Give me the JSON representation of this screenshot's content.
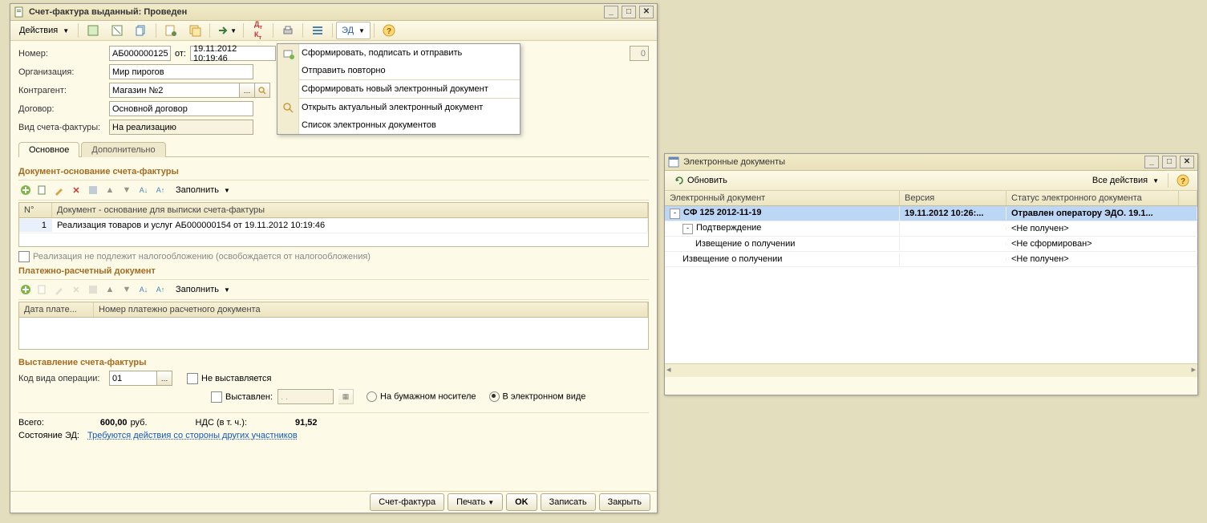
{
  "win1": {
    "title": "Счет-фактура выданный: Проведен",
    "toolbar": {
      "actions": "Действия",
      "ed_label": "ЭД"
    },
    "fields": {
      "number_label": "Номер:",
      "number_value": "АБ000000125",
      "from_label": "от:",
      "date_value": "19.11.2012 10:19:46",
      "right_zero": "0",
      "org_label": "Организация:",
      "org_value": "Мир пирогов",
      "counter_label": "Контрагент:",
      "counter_value": "Магазин №2",
      "contract_label": "Договор:",
      "contract_value": "Основной договор",
      "type_label": "Вид счета-фактуры:",
      "type_value": "На реализацию"
    },
    "tabs": {
      "main": "Основное",
      "extra": "Дополнительно"
    },
    "section1": {
      "title": "Документ-основание счета-фактуры",
      "fill": "Заполнить",
      "col_n": "N°",
      "col_doc": "Документ - основание для выписки счета-фактуры",
      "row_n": "1",
      "row_doc": "Реализация товаров и услуг АБ000000154 от 19.11.2012 10:19:46",
      "taxfree": "Реализация не подлежит налогообложению (освобождается от налогообложения)"
    },
    "section2": {
      "title": "Платежно-расчетный документ",
      "fill": "Заполнить",
      "col_date": "Дата плате...",
      "col_num": "Номер платежно расчетного документа"
    },
    "section3": {
      "title": "Выставление счета-фактуры",
      "opcode_label": "Код вида операции:",
      "opcode_value": "01",
      "not_issued": "Не выставляется",
      "issued": "Выставлен:",
      "issued_date": ". .",
      "paper": "На бумажном носителе",
      "electronic": "В электронном виде"
    },
    "totals": {
      "total_label": "Всего:",
      "total_value": "600,00",
      "currency": "руб.",
      "nds_label": "НДС (в т. ч.):",
      "nds_value": "91,52",
      "state_label": "Состояние ЭД:",
      "state_link": "Требуются действия со стороны других участников"
    },
    "footer": {
      "invoice": "Счет-фактура",
      "print": "Печать",
      "ok": "OK",
      "save": "Записать",
      "close": "Закрыть"
    },
    "dropdown": {
      "i1": "Сформировать, подписать и отправить",
      "i2": "Отправить повторно",
      "i3": "Сформировать новый электронный документ",
      "i4": "Открыть актуальный электронный документ",
      "i5": "Список электронных документов"
    }
  },
  "win2": {
    "title": "Электронные документы",
    "toolbar": {
      "refresh": "Обновить",
      "all_actions": "Все действия"
    },
    "cols": {
      "doc": "Электронный документ",
      "ver": "Версия",
      "status": "Статус электронного документа"
    },
    "rows": [
      {
        "name": "СФ 125 2012-11-19",
        "ver": "19.11.2012 10:26:...",
        "status": "Отравлен оператору ЭДО. 19.1...",
        "indent": 0,
        "expander": "-",
        "sel": true,
        "bold": true
      },
      {
        "name": "Подтверждение",
        "ver": "",
        "status": "<Не получен>",
        "indent": 1,
        "expander": "-",
        "sel": false,
        "bold": false
      },
      {
        "name": "Извещение о получении",
        "ver": "",
        "status": "<Не сформирован>",
        "indent": 2,
        "expander": "",
        "sel": false,
        "bold": false
      },
      {
        "name": "Извещение о получении",
        "ver": "",
        "status": "<Не получен>",
        "indent": 1,
        "expander": "",
        "sel": false,
        "bold": false
      }
    ]
  }
}
